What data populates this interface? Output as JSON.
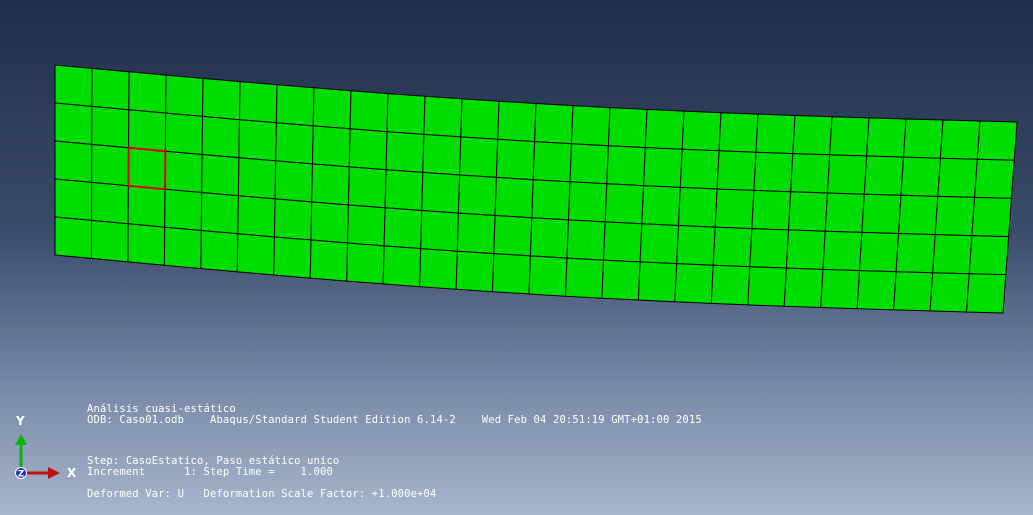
{
  "viewport": {
    "mesh": {
      "element_columns": 26,
      "element_rows": 5,
      "fill_color": "#00dd00",
      "edge_color": "#000000",
      "highlight_color": "#dd0000",
      "highlighted_element": {
        "column": 2,
        "row": 2
      }
    },
    "triad": {
      "x_label": "X",
      "y_label": "Y",
      "z_label": "Z",
      "x_color": "#c01010",
      "y_color": "#10b010",
      "z_color": "#2030c0"
    },
    "info": {
      "title": "Análisis cuasi-estático",
      "odb": "ODB: Caso01.odb",
      "solver": "Abaqus/Standard Student Edition 6.14-2",
      "date": "Wed Feb 04 20:51:19 GMT+01:00 2015",
      "step": "Step: CasoEstatico, Paso estático unico",
      "increment": "Increment      1: Step Time =    1.000",
      "deformed": "Deformed Var: U   Deformation Scale Factor: +1.000e+04"
    }
  }
}
